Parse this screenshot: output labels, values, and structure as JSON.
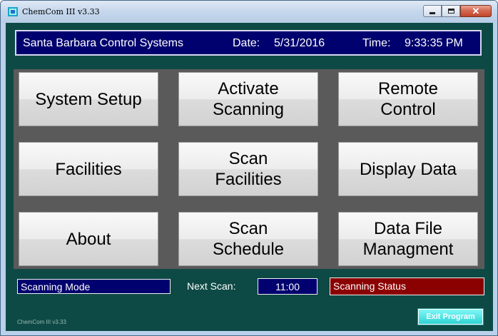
{
  "window": {
    "title": "ChemCom III v3.33",
    "icon": "app-icon",
    "controls": {
      "minimize": "minimize-icon",
      "maximize": "maximize-icon",
      "close": "close-icon",
      "close_glyph": "✕"
    }
  },
  "header": {
    "company": "Santa Barbara Control Systems",
    "date_label": "Date:",
    "date_value": "5/31/2016",
    "time_label": "Time:",
    "time_value": "9:33:35 PM"
  },
  "buttons": [
    {
      "label": "System Setup"
    },
    {
      "label": "Activate\nScanning"
    },
    {
      "label": "Remote\nControl"
    },
    {
      "label": "Facilities"
    },
    {
      "label": "Scan\nFacilities"
    },
    {
      "label": "Display Data"
    },
    {
      "label": "About"
    },
    {
      "label": "Scan\nSchedule"
    },
    {
      "label": "Data File\nManagment"
    }
  ],
  "status": {
    "mode": "Scanning Mode",
    "next_scan_label": "Next Scan:",
    "next_scan_value": "11:00",
    "scanning_status": "Scanning Status"
  },
  "footer": {
    "version": "ChemCom III v3.33",
    "exit_label": "Exit Program"
  },
  "colors": {
    "background": "#0e4a45",
    "header_bg": "#00006e",
    "mode_bg": "#00006e",
    "status_bg": "#8b0000",
    "exit_bg": "#2fd3d3"
  }
}
